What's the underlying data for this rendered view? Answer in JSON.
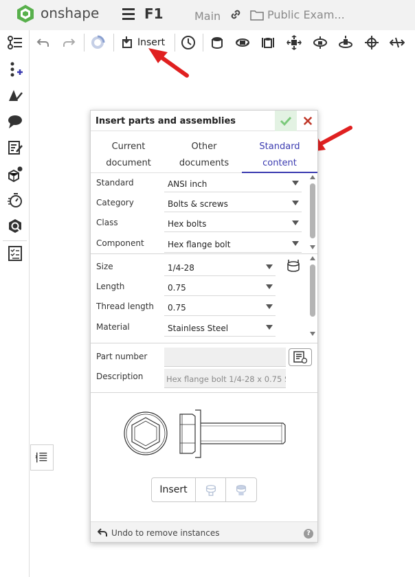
{
  "app": {
    "brand": "onshape",
    "document_title": "F1",
    "branch": "Main",
    "folder_label": "Public Exam..."
  },
  "left_toolbar": {
    "icons": [
      "feature-list-icon",
      "add-point-icon",
      "appearance-icon",
      "comment-icon",
      "notes-icon",
      "mate-connector-icon",
      "timer-icon",
      "search-icon",
      "checklist-icon"
    ]
  },
  "feature_toolbar": {
    "insert_label": "Insert",
    "icons": [
      "undo-icon",
      "redo-icon",
      "spinner-icon",
      "insert-icon",
      "timeline-icon",
      "cylinder-icon",
      "revolute-icon",
      "slider-icon",
      "planar-icon",
      "ball-icon",
      "pin-slot-icon",
      "parallel-icon",
      "move-icon",
      "mirror-icon"
    ]
  },
  "dialog": {
    "title": "Insert parts and assemblies",
    "tabs": [
      {
        "label_line1": "Current",
        "label_line2": "document",
        "active": false
      },
      {
        "label_line1": "Other",
        "label_line2": "documents",
        "active": false
      },
      {
        "label_line1": "Standard",
        "label_line2": "content",
        "active": true
      }
    ],
    "fields_group1": [
      {
        "label": "Standard",
        "value": "ANSI inch"
      },
      {
        "label": "Category",
        "value": "Bolts & screws"
      },
      {
        "label": "Class",
        "value": "Hex bolts"
      },
      {
        "label": "Component",
        "value": "Hex flange bolt"
      }
    ],
    "fields_group2": [
      {
        "label": "Size",
        "value": "1/4-28"
      },
      {
        "label": "Length",
        "value": "0.75"
      },
      {
        "label": "Thread length",
        "value": "0.75"
      },
      {
        "label": "Material",
        "value": "Stainless Steel"
      }
    ],
    "part_number_label": "Part number",
    "part_number_value": "",
    "description_label": "Description",
    "description_value": "Hex flange bolt 1/4-28 x 0.75 S",
    "insert_button": "Insert",
    "undo_text": "Undo to remove instances",
    "help_glyph": "?"
  },
  "colors": {
    "accent": "#3a3ab0",
    "arrow_red": "#e02020",
    "ok_green": "#7ac97a",
    "close_red": "#c0392b",
    "brand_green": "#4caf50"
  }
}
